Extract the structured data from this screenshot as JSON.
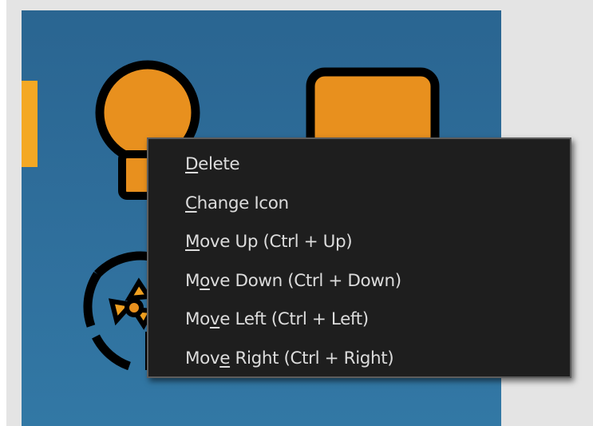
{
  "context_menu": {
    "items": [
      {
        "label": "Delete",
        "accelerator_index": 0,
        "id": "delete"
      },
      {
        "label": "Change Icon",
        "accelerator_index": 0,
        "id": "change-icon"
      },
      {
        "label": "Move Up (Ctrl + Up)",
        "accelerator_index": 0,
        "id": "move-up"
      },
      {
        "label": "Move Down (Ctrl + Down)",
        "accelerator_index": 1,
        "id": "move-down"
      },
      {
        "label": "Move Left (Ctrl + Left)",
        "accelerator_index": 2,
        "id": "move-left"
      },
      {
        "label": "Move Right (Ctrl + Right)",
        "accelerator_index": 3,
        "id": "move-right"
      }
    ]
  },
  "icons": {
    "lightbulb": "lightbulb-icon",
    "square": "square-tile-icon",
    "fan": "fan-icon"
  },
  "colors": {
    "panel": "#2f6f9c",
    "icon_fill": "#e8901e",
    "icon_outline": "#000000",
    "edge_tab": "#f4a824",
    "menu_bg": "#1e1e1e",
    "menu_border": "#5d5d5d",
    "menu_text": "#dcdcdc",
    "page_bg": "#e4e4e4"
  }
}
